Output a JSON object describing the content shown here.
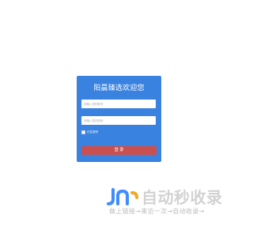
{
  "login": {
    "title": "阳晨臻选欢迎您",
    "username_placeholder": "请输入您的账号",
    "password_placeholder": "请输入您的密码",
    "remember_label": "记住密码",
    "submit_label": "登 录"
  },
  "watermark": {
    "brand": "自动秒收录",
    "tagline": "做上链接→来访一次→自动收录→"
  },
  "colors": {
    "card_bg": "#3a82e0",
    "button_bg": "#c9504f",
    "watermark_gray": "#d2d2d2",
    "logo_blue": "#3f8cff",
    "logo_orange": "#f5a623"
  }
}
